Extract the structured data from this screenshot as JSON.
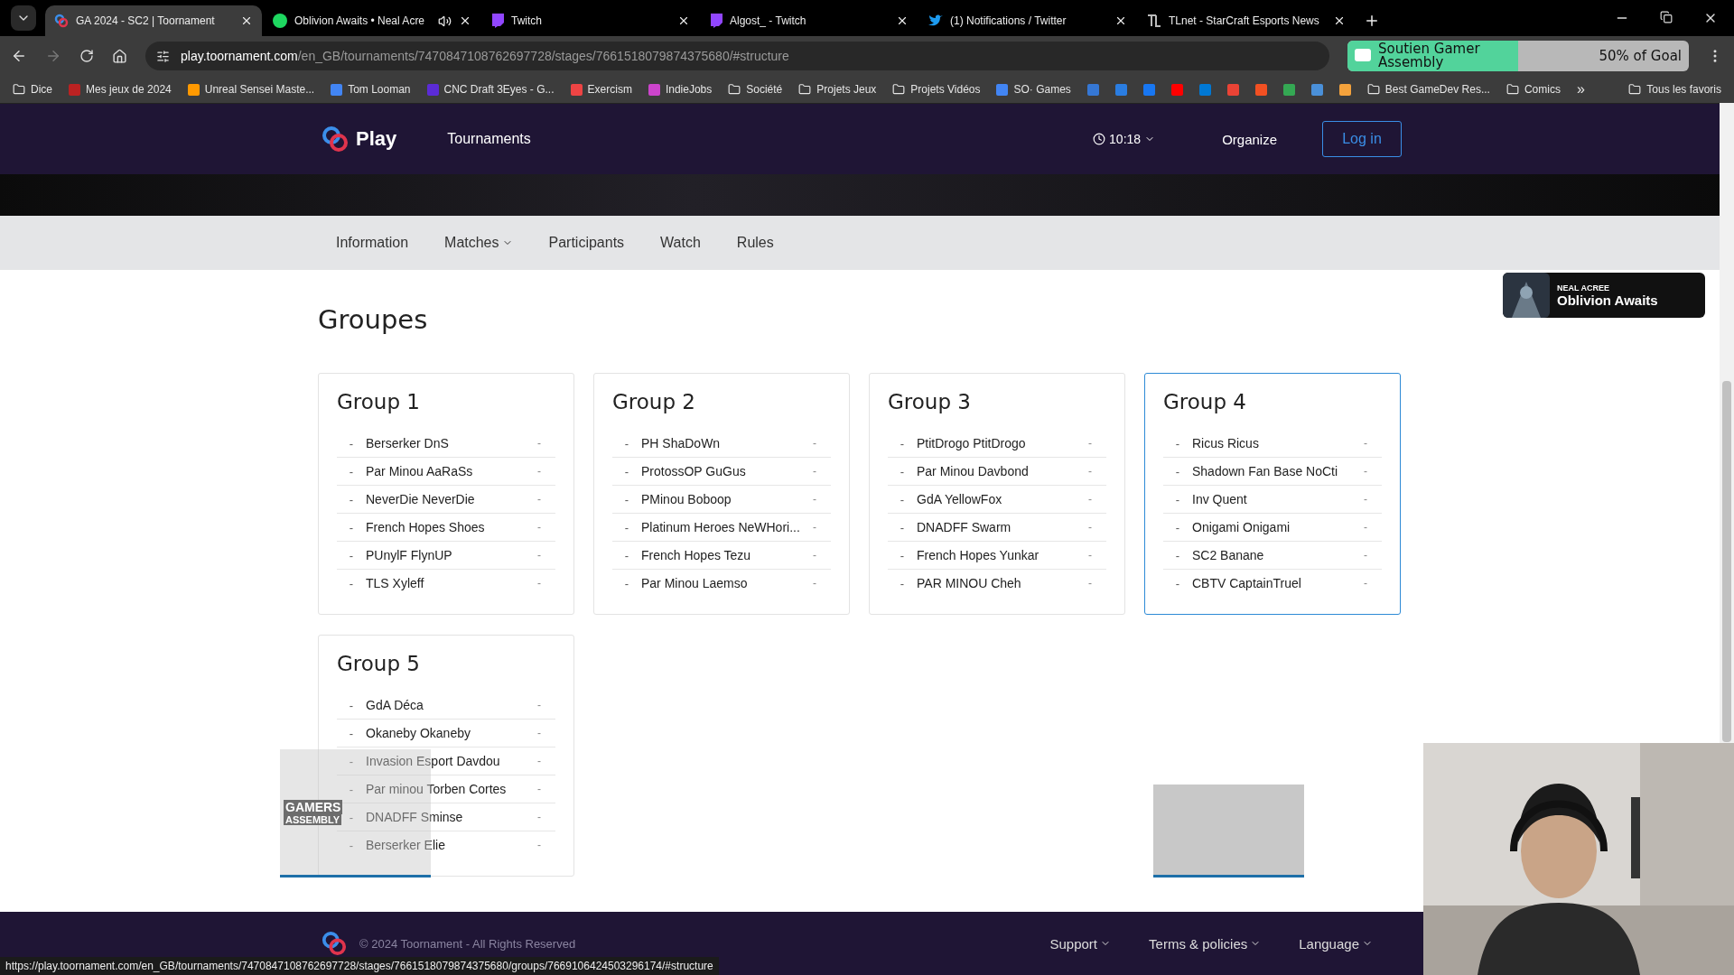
{
  "browser": {
    "tabs": [
      {
        "title": "GA 2024 - SC2 | Toornament",
        "kind": "toornament",
        "selected": true,
        "audio": false
      },
      {
        "title": "Oblivion Awaits • Neal Acre",
        "kind": "spotify",
        "selected": false,
        "audio": true
      },
      {
        "title": "Twitch",
        "kind": "twitch",
        "selected": false,
        "audio": false
      },
      {
        "title": "Algost_ - Twitch",
        "kind": "twitch",
        "selected": false,
        "audio": false
      },
      {
        "title": "(1) Notifications / Twitter",
        "kind": "twitter",
        "selected": false,
        "audio": false
      },
      {
        "title": "TLnet - StarCraft Esports News",
        "kind": "tlnet",
        "selected": false,
        "audio": false
      }
    ],
    "address": {
      "host": "play.toornament.com",
      "path": "/en_GB/tournaments/7470847108762697728/stages/7661518079874375680/#structure"
    },
    "extension": {
      "title": "Soutien Gamer Assembly",
      "goal": "50% of Goal",
      "level": 0.5
    },
    "bookmarks": [
      {
        "label": "Dice",
        "kind": "folder"
      },
      {
        "label": "Mes jeux de 2024",
        "kind": "site"
      },
      {
        "label": "Unreal Sensei Maste...",
        "kind": "site"
      },
      {
        "label": "Tom Looman",
        "kind": "site"
      },
      {
        "label": "CNC Draft 3Eyes - G...",
        "kind": "site"
      },
      {
        "label": "Exercism",
        "kind": "site"
      },
      {
        "label": "IndieJobs",
        "kind": "site"
      },
      {
        "label": "Société",
        "kind": "folder"
      },
      {
        "label": "Projets Jeux",
        "kind": "folder"
      },
      {
        "label": "Projets Vidéos",
        "kind": "folder"
      },
      {
        "label": "SO· Games",
        "kind": "site"
      },
      {
        "label": "Best GameDev Res...",
        "kind": "folder"
      },
      {
        "label": "Comics",
        "kind": "folder"
      }
    ],
    "more_bookmarks": "»",
    "all_bookmarks": "Tous les favoris"
  },
  "site": {
    "logo": "Play",
    "nav": "Tournaments",
    "time": "10:18",
    "organize": "Organize",
    "login": "Log in"
  },
  "subnav": [
    {
      "label": "Information",
      "has_menu": false
    },
    {
      "label": "Matches",
      "has_menu": true
    },
    {
      "label": "Participants",
      "has_menu": false
    },
    {
      "label": "Watch",
      "has_menu": false
    },
    {
      "label": "Rules",
      "has_menu": false
    }
  ],
  "heading": "Groupes",
  "groups": [
    {
      "title": "Group 1",
      "highlighted": false,
      "participants": [
        {
          "rank": "-",
          "name": "Berserker DnS",
          "score": "-"
        },
        {
          "rank": "-",
          "name": "Par Minou AaRaSs",
          "score": "-"
        },
        {
          "rank": "-",
          "name": "NeverDie NeverDie",
          "score": "-"
        },
        {
          "rank": "-",
          "name": "French Hopes Shoes",
          "score": "-"
        },
        {
          "rank": "-",
          "name": "PUnylF FlynUP",
          "score": "-"
        },
        {
          "rank": "-",
          "name": "TLS Xyleff",
          "score": "-"
        }
      ]
    },
    {
      "title": "Group 2",
      "highlighted": false,
      "participants": [
        {
          "rank": "-",
          "name": "PH ShaDoWn",
          "score": "-"
        },
        {
          "rank": "-",
          "name": "ProtossOP GuGus",
          "score": "-"
        },
        {
          "rank": "-",
          "name": "PMinou Boboop",
          "score": "-"
        },
        {
          "rank": "-",
          "name": "Platinum Heroes NeWHori...",
          "score": "-"
        },
        {
          "rank": "-",
          "name": "French Hopes Tezu",
          "score": "-"
        },
        {
          "rank": "-",
          "name": "Par Minou Laemso",
          "score": "-"
        }
      ]
    },
    {
      "title": "Group 3",
      "highlighted": false,
      "participants": [
        {
          "rank": "-",
          "name": "PtitDrogo PtitDrogo",
          "score": "-"
        },
        {
          "rank": "-",
          "name": "Par Minou Davbond",
          "score": "-"
        },
        {
          "rank": "-",
          "name": "GdA YellowFox",
          "score": "-"
        },
        {
          "rank": "-",
          "name": "DNADFF Swarm",
          "score": "-"
        },
        {
          "rank": "-",
          "name": "French Hopes Yunkar",
          "score": "-"
        },
        {
          "rank": "-",
          "name": "PAR MINOU Cheh",
          "score": "-"
        }
      ]
    },
    {
      "title": "Group 4",
      "highlighted": true,
      "participants": [
        {
          "rank": "-",
          "name": "Ricus Ricus",
          "score": "-"
        },
        {
          "rank": "-",
          "name": "Shadown Fan Base NoCti",
          "score": "-"
        },
        {
          "rank": "-",
          "name": "Inv Quent",
          "score": "-"
        },
        {
          "rank": "-",
          "name": "Onigami Onigami",
          "score": "-"
        },
        {
          "rank": "-",
          "name": "SC2 Banane",
          "score": "-"
        },
        {
          "rank": "-",
          "name": "CBTV CaptainTruel",
          "score": "-"
        }
      ]
    },
    {
      "title": "Group 5",
      "highlighted": false,
      "participants": [
        {
          "rank": "-",
          "name": "GdA Déca",
          "score": "-"
        },
        {
          "rank": "-",
          "name": "Okaneby Okaneby",
          "score": "-"
        },
        {
          "rank": "-",
          "name": "Invasion Esport Davdou",
          "score": "-"
        },
        {
          "rank": "-",
          "name": "Par minou Torben Cortes",
          "score": "-"
        },
        {
          "rank": "-",
          "name": "DNADFF Sminse",
          "score": "-"
        },
        {
          "rank": "-",
          "name": "Berserker Elie",
          "score": "-"
        }
      ]
    }
  ],
  "now_playing": {
    "artist": "NEAL ACREE",
    "title": "Oblivion Awaits"
  },
  "stream_overlay": {
    "line_1": "GAMERS",
    "line_2": "ASSEMBLY"
  },
  "footer": {
    "copyright": "© 2024 Toornament - All Rights Reserved",
    "links": [
      "Support",
      "Terms & policies",
      "Language"
    ]
  },
  "status_url": "https://play.toornament.com/en_GB/tournaments/7470847108762697728/stages/7661518079874375680/groups/7669106424503296174/#structure"
}
